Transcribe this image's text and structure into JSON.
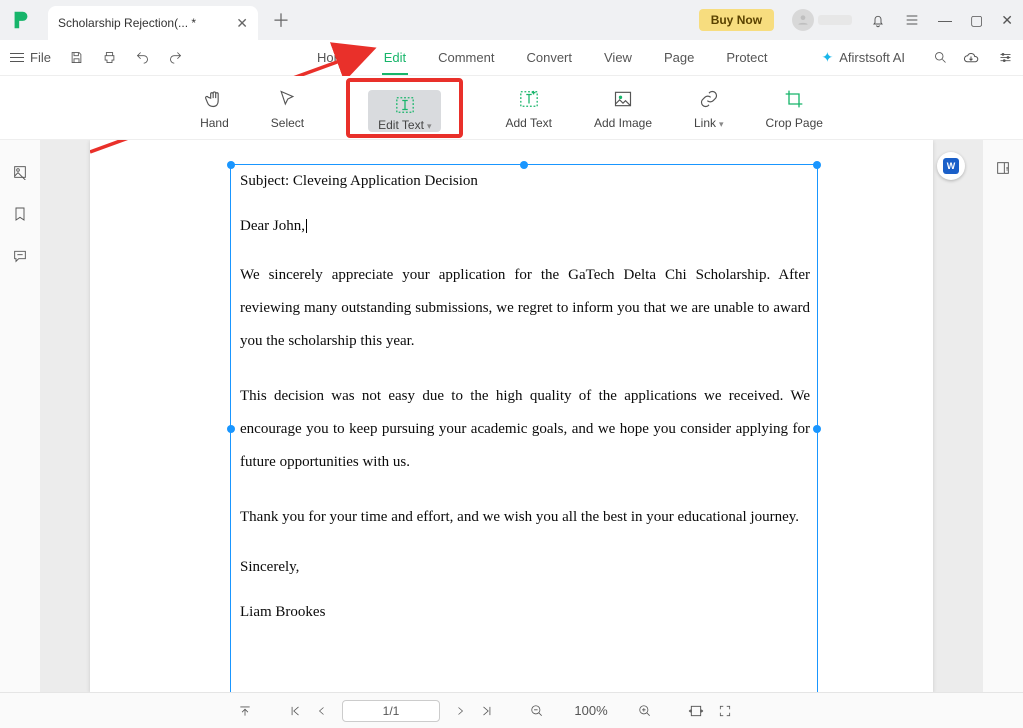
{
  "titlebar": {
    "tab_title": "Scholarship Rejection(... *",
    "buy_now": "Buy Now"
  },
  "menubar": {
    "file_label": "File",
    "tabs": {
      "home": "Home",
      "edit": "Edit",
      "comment": "Comment",
      "convert": "Convert",
      "view": "View",
      "page": "Page",
      "protect": "Protect"
    },
    "ai_label": "Afirstsoft AI"
  },
  "toolbar": {
    "hand": "Hand",
    "select": "Select",
    "edit_text": "Edit Text",
    "add_text": "Add Text",
    "add_image": "Add Image",
    "link": "Link",
    "crop_page": "Crop Page"
  },
  "doc": {
    "subject": "Subject:  Cleveing Application Decision",
    "salutation": "Dear John,",
    "p1": "We sincerely appreciate your application for the GaTech Delta Chi Scholarship. After reviewing many outstanding  submissions, we regret to inform you that we are  unable to award you   the scholarship  this year.",
    "p2": "This decision was not easy due to the high quality of the applications we received. We encourage you to keep pursuing your academic goals, and we hope you consider applying for future opportunities with us.",
    "p3": "Thank you for your time and effort, and we wish you all the best in your educational journey.",
    "closing": "Sincerely,",
    "signature": "Liam Brookes"
  },
  "status": {
    "page": "1/1",
    "zoom": "100%"
  }
}
